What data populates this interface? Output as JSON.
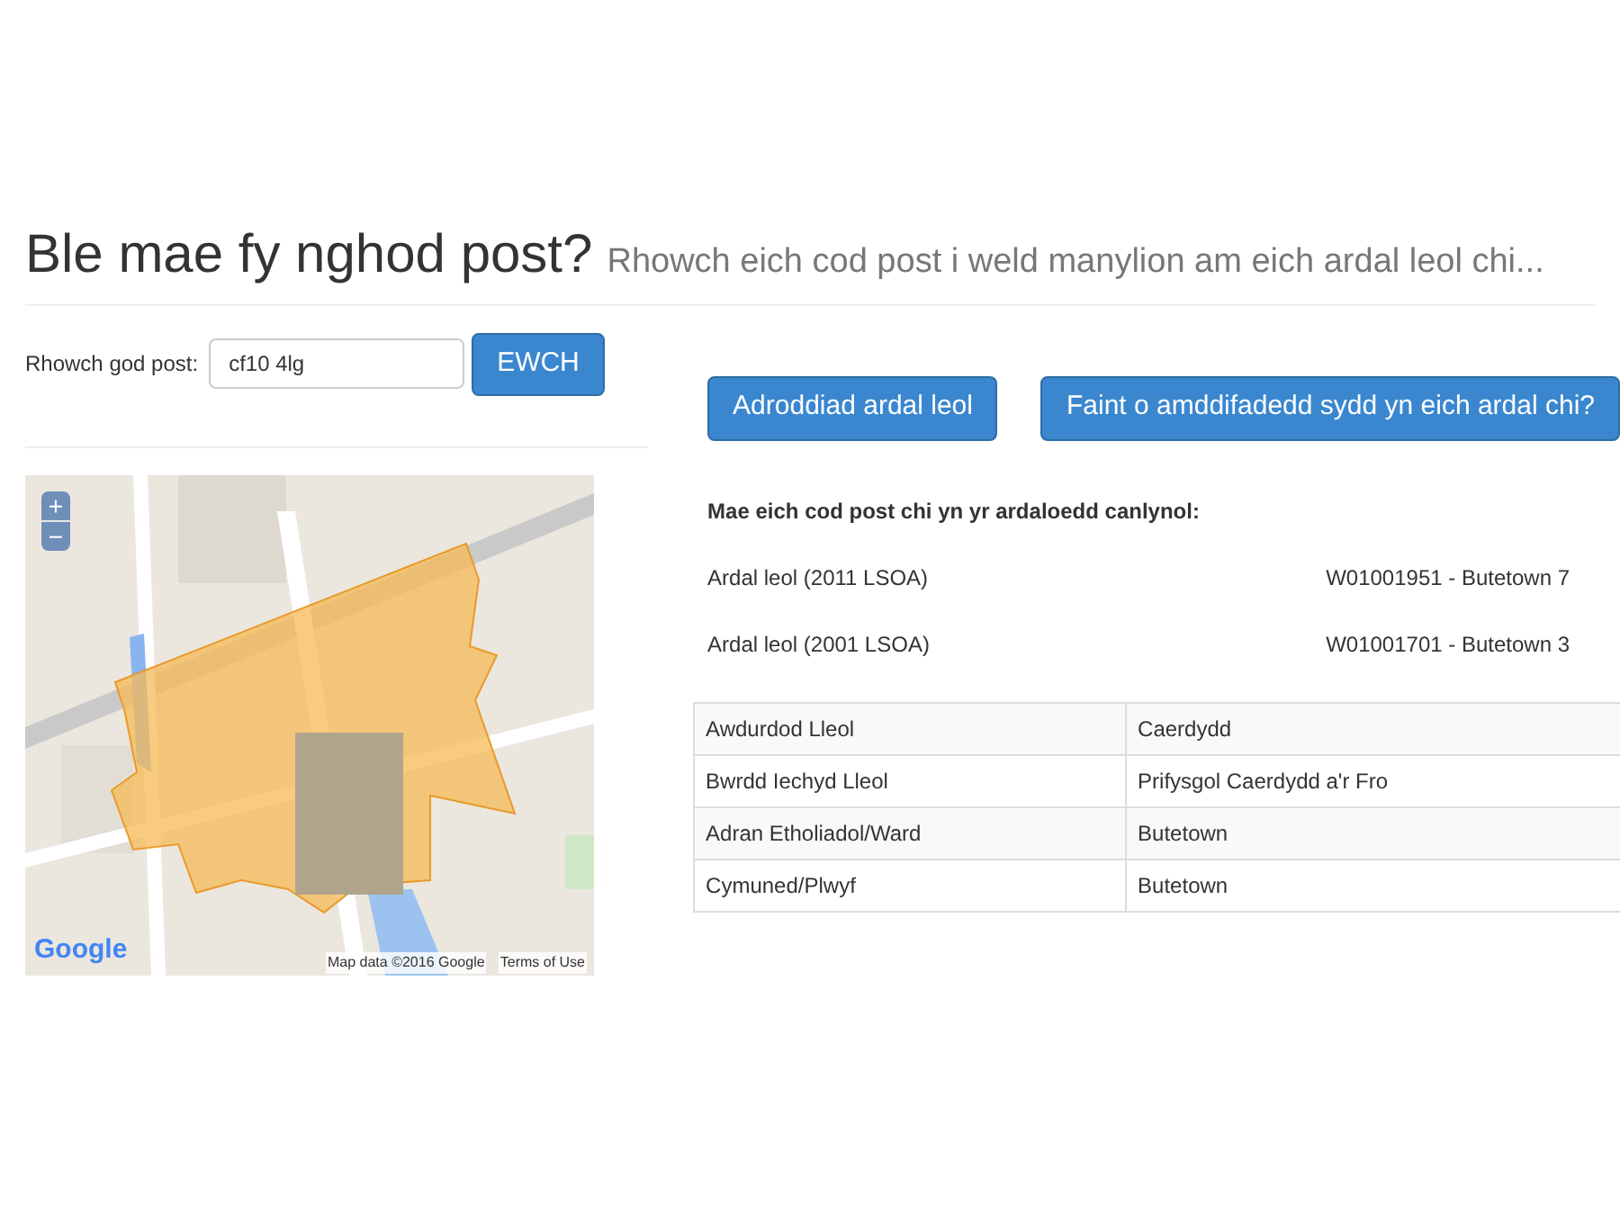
{
  "header": {
    "title": "Ble mae fy nghod post?",
    "subtitle": "Rhowch eich cod post i weld manylion am eich ardal leol chi..."
  },
  "search": {
    "label": "Rhowch god post:",
    "value": "cf10 4lg",
    "button": "EWCH"
  },
  "map": {
    "kind": "picture",
    "zoom_in": "+",
    "zoom_out": "−",
    "logo": "Google",
    "attribution": "Map data ©2016 Google",
    "terms": "Terms of Use"
  },
  "actions": [
    "Adroddiad ardal leol",
    "Faint o amddifadedd sydd yn eich ardal chi?"
  ],
  "areas": {
    "heading": "Mae eich cod post chi yn yr ardaloedd canlynol:",
    "rows": [
      {
        "label": "Ardal leol (2011 LSOA)",
        "value": "W01001951 - Butetown 7"
      },
      {
        "label": "Ardal leol (2001 LSOA)",
        "value": "W01001701 - Butetown 3"
      }
    ]
  },
  "table": {
    "rows": [
      [
        "Awdurdod Lleol",
        "Caerdydd"
      ],
      [
        "Bwrdd Iechyd Lleol",
        "Prifysgol Caerdydd a'r Fro"
      ],
      [
        "Adran Etholiadol/Ward",
        "Butetown"
      ],
      [
        "Cymuned/Plwyf",
        "Butetown"
      ]
    ]
  }
}
